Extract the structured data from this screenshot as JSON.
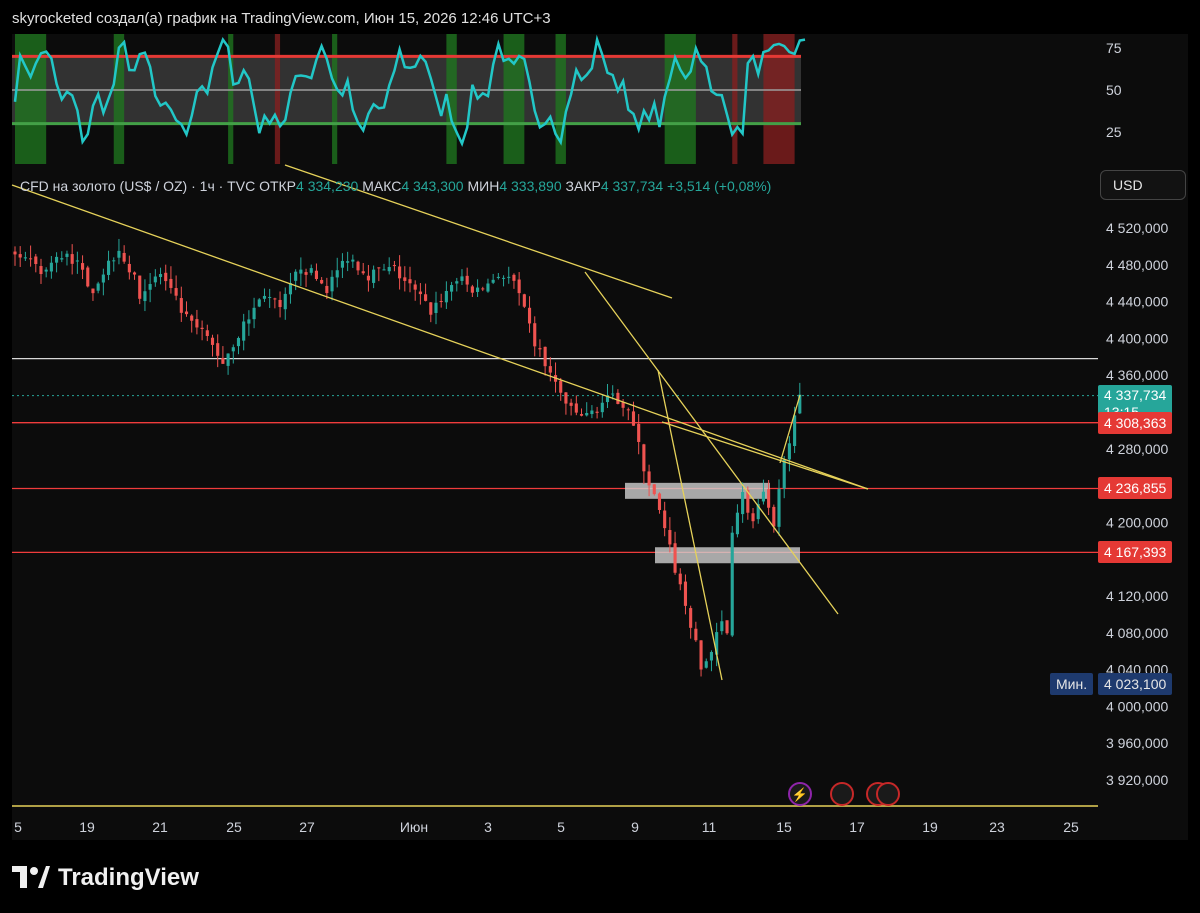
{
  "header": {
    "title": "skyrocketed создал(а) график на TradingView.com, Июн 15, 2026 12:46 UTC+3"
  },
  "legend": {
    "symbol": "CFD на золото (US$ / OZ) · 1ч · TVC",
    "open_label": "ОТКР",
    "open": "4 334,230",
    "high_label": "МАКС",
    "high": "4 343,300",
    "low_label": "МИН",
    "low": "4 333,890",
    "close_label": "ЗАКР",
    "close": "4 337,734",
    "change": "+3,514 (+0,08%)"
  },
  "currency_button": "USD",
  "footer": {
    "brand": "TradingView"
  },
  "colors": {
    "bull": "#26a69a",
    "bear": "#ef5350",
    "trend": "#e6d25a",
    "level": "#f03c3c",
    "osc": "#22c7c7"
  },
  "oscillator": {
    "yticks": [
      {
        "v": 25,
        "label": "25"
      },
      {
        "v": 50,
        "label": "50"
      },
      {
        "v": 75,
        "label": "75"
      }
    ],
    "upper_band": 70,
    "lower_band": 30,
    "mid": 50
  },
  "chart_data": {
    "type": "candlestick",
    "x_axis_labels": [
      "5",
      "19",
      "21",
      "25",
      "27",
      "Июн",
      "3",
      "5",
      "9",
      "11",
      "15",
      "17",
      "19",
      "23",
      "25"
    ],
    "y_ticks": [
      "4 520,000",
      "4 480,000",
      "4 440,000",
      "4 400,000",
      "4 360,000",
      "4 280,000",
      "4 200,000",
      "4 120,000",
      "4 080,000",
      "4 040,000",
      "4 000,000",
      "3 960,000",
      "3 920,000"
    ],
    "ylim": [
      3880,
      4560
    ],
    "path": [
      [
        0,
        4495
      ],
      [
        5,
        4470
      ],
      [
        10,
        4495
      ],
      [
        15,
        4455
      ],
      [
        20,
        4500
      ],
      [
        24,
        4450
      ],
      [
        28,
        4470
      ],
      [
        33,
        4420
      ],
      [
        37,
        4400
      ],
      [
        40,
        4375
      ],
      [
        43,
        4405
      ],
      [
        48,
        4450
      ],
      [
        51,
        4430
      ],
      [
        55,
        4480
      ],
      [
        60,
        4455
      ],
      [
        64,
        4490
      ],
      [
        68,
        4470
      ],
      [
        73,
        4475
      ],
      [
        77,
        4450
      ],
      [
        80,
        4430
      ],
      [
        85,
        4465
      ],
      [
        89,
        4450
      ],
      [
        93,
        4470
      ],
      [
        96,
        4460
      ],
      [
        100,
        4395
      ],
      [
        104,
        4350
      ],
      [
        107,
        4320
      ],
      [
        110,
        4315
      ],
      [
        113,
        4330
      ],
      [
        116,
        4335
      ],
      [
        118,
        4325
      ],
      [
        121,
        4260
      ],
      [
        124,
        4210
      ],
      [
        127,
        4150
      ],
      [
        130,
        4090
      ],
      [
        132,
        4040
      ],
      [
        134,
        4060
      ],
      [
        136,
        4090
      ],
      [
        137,
        4080
      ],
      [
        138,
        4195
      ],
      [
        140,
        4230
      ],
      [
        142,
        4200
      ],
      [
        144,
        4230
      ],
      [
        146,
        4190
      ],
      [
        148,
        4275
      ],
      [
        150,
        4310
      ],
      [
        151,
        4333
      ]
    ],
    "current_price": {
      "value": 4337.734,
      "label": "4 337,734",
      "countdown": "13:15"
    },
    "levels": [
      {
        "value": 4378,
        "color": "#d8d8d8"
      },
      {
        "value": 4308.363,
        "label": "4 308,363",
        "color": "#f03c3c"
      },
      {
        "value": 4236.855,
        "label": "4 236,855",
        "color": "#f03c3c"
      },
      {
        "value": 4167.393,
        "label": "4 167,393",
        "color": "#f03c3c"
      },
      {
        "value": 3902,
        "color": "#e6d25a"
      }
    ],
    "min": {
      "label_tag": "Мин.",
      "value": "4 023,100"
    }
  }
}
